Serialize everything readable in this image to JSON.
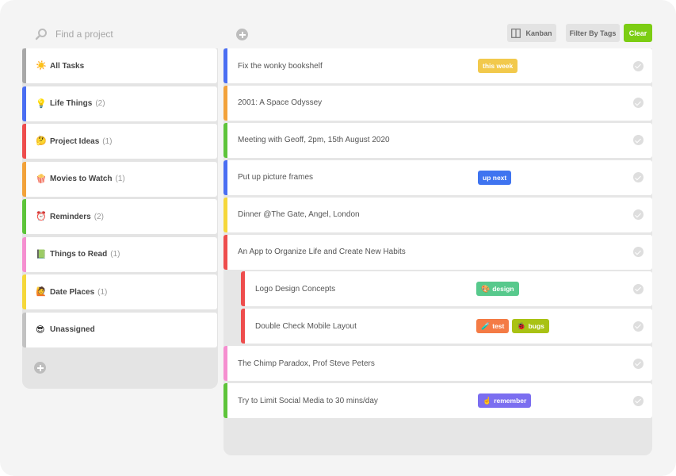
{
  "search": {
    "placeholder": "Find a project"
  },
  "toolbar": {
    "kanban_label": "Kanban",
    "filter_label": "Filter By Tags",
    "clear_label": "Clear"
  },
  "colors": {
    "accent_green": "#7ccd13",
    "blue": "#4a6ef2",
    "orange": "#f2a23a",
    "red": "#ee4d4d",
    "green": "#5dc43a",
    "pink": "#f58fd0",
    "yellow": "#f5d73a",
    "gray": "#a8a8a8"
  },
  "projects": [
    {
      "label": "All Tasks",
      "count": "",
      "icon": "sun-icon",
      "emoji": "☀️",
      "color": "#a8a8a8"
    },
    {
      "label": "Life Things",
      "count": "(2)",
      "icon": "lightbulb-icon",
      "emoji": "💡",
      "color": "#4a6ef2"
    },
    {
      "label": "Project Ideas",
      "count": "(1)",
      "icon": "thinking-face-icon",
      "emoji": "🤔",
      "color": "#ee4d4d"
    },
    {
      "label": "Movies to Watch",
      "count": "(1)",
      "icon": "popcorn-icon",
      "emoji": "🍿",
      "color": "#f2a23a"
    },
    {
      "label": "Reminders",
      "count": "(2)",
      "icon": "alarm-clock-icon",
      "emoji": "⏰",
      "color": "#5dc43a"
    },
    {
      "label": "Things to Read",
      "count": "(1)",
      "icon": "book-icon",
      "emoji": "📗",
      "color": "#f58fd0"
    },
    {
      "label": "Date Places",
      "count": "(1)",
      "icon": "woman-icon",
      "emoji": "🙋",
      "color": "#f5d73a"
    },
    {
      "label": "Unassigned",
      "count": "",
      "icon": "sunglasses-face-icon",
      "emoji": "😎",
      "color": "#c2c2c2"
    }
  ],
  "tasks": [
    {
      "title": "Fix the wonky bookshelf",
      "color": "#4a6ef2",
      "sub": false,
      "tags": [
        {
          "label": "this week",
          "icon": "",
          "bg": "#f2c94c"
        }
      ]
    },
    {
      "title": "2001: A Space Odyssey",
      "color": "#f2a23a",
      "sub": false,
      "tags": []
    },
    {
      "title": "Meeting with Geoff, 2pm, 15th August 2020",
      "color": "#5dc43a",
      "sub": false,
      "tags": []
    },
    {
      "title": "Put up picture frames",
      "color": "#4a6ef2",
      "sub": false,
      "tags": [
        {
          "label": "up next",
          "icon": "",
          "bg": "#3f74f0"
        }
      ]
    },
    {
      "title": "Dinner @The Gate, Angel, London",
      "color": "#f5d73a",
      "sub": false,
      "tags": []
    },
    {
      "title": "An App to Organize Life and Create New Habits",
      "color": "#ee4d4d",
      "sub": false,
      "tags": []
    },
    {
      "title": "Logo Design Concepts",
      "color": "#ee4d4d",
      "sub": true,
      "tags": [
        {
          "label": "design",
          "icon": "🎨",
          "bg": "#57c98c"
        }
      ]
    },
    {
      "title": "Double Check Mobile Layout",
      "color": "#ee4d4d",
      "sub": true,
      "tags": [
        {
          "label": "test",
          "icon": "🧪",
          "bg": "#f47b45"
        },
        {
          "label": "bugs",
          "icon": "🐞",
          "bg": "#a9c214"
        }
      ]
    },
    {
      "title": "The Chimp Paradox, Prof Steve Peters",
      "color": "#f58fd0",
      "sub": false,
      "tags": []
    },
    {
      "title": "Try to Limit Social Media to 30 mins/day",
      "color": "#5dc43a",
      "sub": false,
      "tags": [
        {
          "label": "remember",
          "icon": "☝️",
          "bg": "#7b6ef0"
        }
      ]
    }
  ]
}
